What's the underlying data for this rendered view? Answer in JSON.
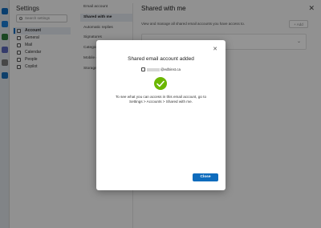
{
  "settings": {
    "title": "Settings",
    "search_placeholder": "Search settings",
    "categories": [
      {
        "label": "Account",
        "active": true
      },
      {
        "label": "General"
      },
      {
        "label": "Mail"
      },
      {
        "label": "Calendar"
      },
      {
        "label": "People"
      },
      {
        "label": "Copilot"
      }
    ],
    "subitems": [
      {
        "label": "Email account"
      },
      {
        "label": "Shared with me",
        "active": true
      },
      {
        "label": "Automatic replies"
      },
      {
        "label": "Signatures"
      },
      {
        "label": "Categories"
      },
      {
        "label": "Mobile devices"
      },
      {
        "label": "Storage"
      }
    ]
  },
  "pane": {
    "title": "Shared with me",
    "description": "View and manage all shared email accounts you have access to.",
    "add_label": "+ Add"
  },
  "dialog": {
    "title": "Shared email account added",
    "account_domain": "@edbinst.ca",
    "body": "To see what you can access in this email account, go to Settings > Accounts > Shared with me.",
    "close_label": "Close"
  },
  "colors": {
    "accent": "#0f6cbd",
    "success": "#6bb700"
  },
  "icons": {
    "close": "close-icon",
    "check": "checkmark-icon",
    "account": "person-icon"
  }
}
